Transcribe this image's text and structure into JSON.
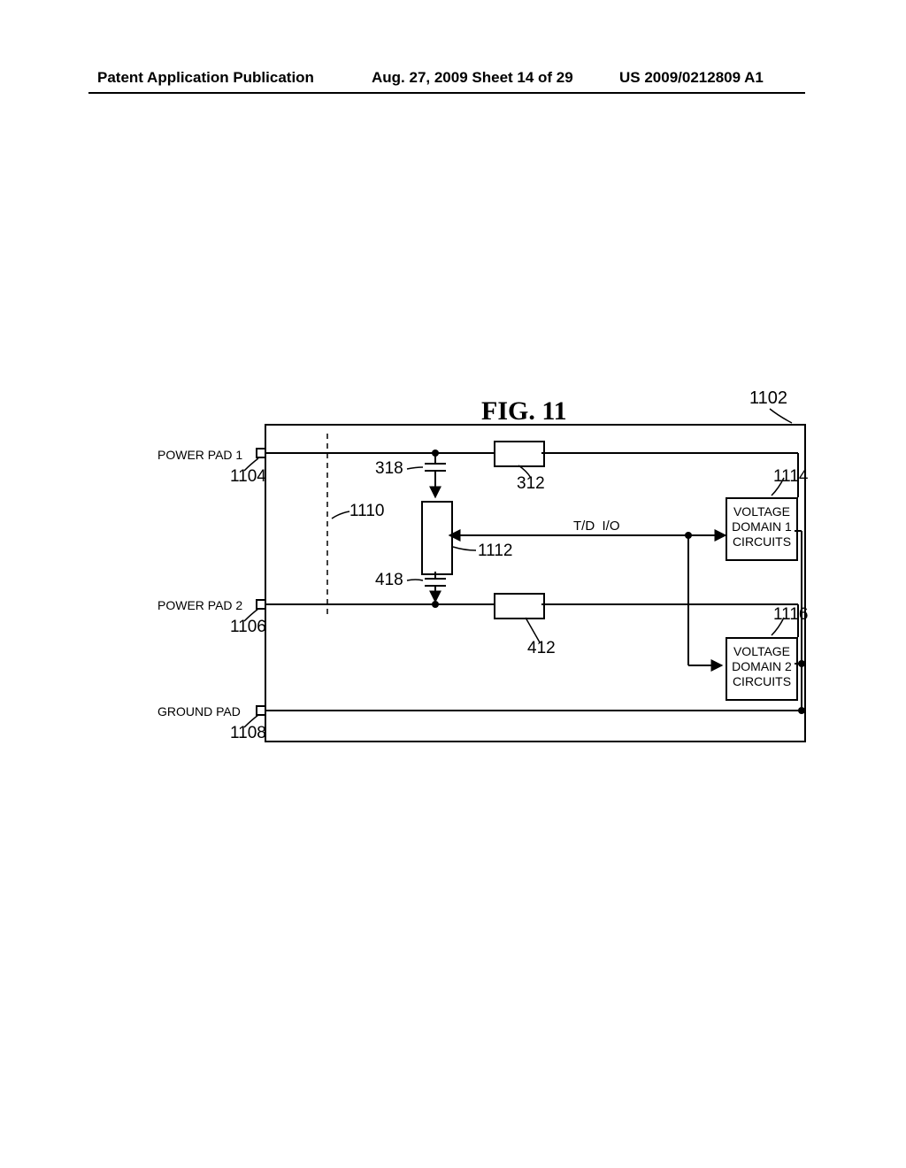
{
  "header": {
    "left": "Patent Application Publication",
    "center": "Aug. 27, 2009  Sheet 14 of 29",
    "right": "US 2009/0212809 A1"
  },
  "figure": {
    "title": "FIG. 11",
    "ref_1102": "1102",
    "pad1_label": "POWER PAD 1",
    "pad1_ref": "1104",
    "pad2_label": "POWER PAD 2",
    "pad2_ref": "1106",
    "gnd_label": "GROUND PAD",
    "gnd_ref": "1108",
    "ref_1110": "1110",
    "ref_318": "318",
    "ref_312": "312",
    "ref_1112": "1112",
    "ref_418": "418",
    "ref_412": "412",
    "ref_1114": "1114",
    "ref_1116": "1116",
    "tdio": "T/D  I/O",
    "block1_l1": "VOLTAGE",
    "block1_l2": "DOMAIN 1",
    "block1_l3": "CIRCUITS",
    "block2_l1": "VOLTAGE",
    "block2_l2": "DOMAIN 2",
    "block2_l3": "CIRCUITS"
  }
}
